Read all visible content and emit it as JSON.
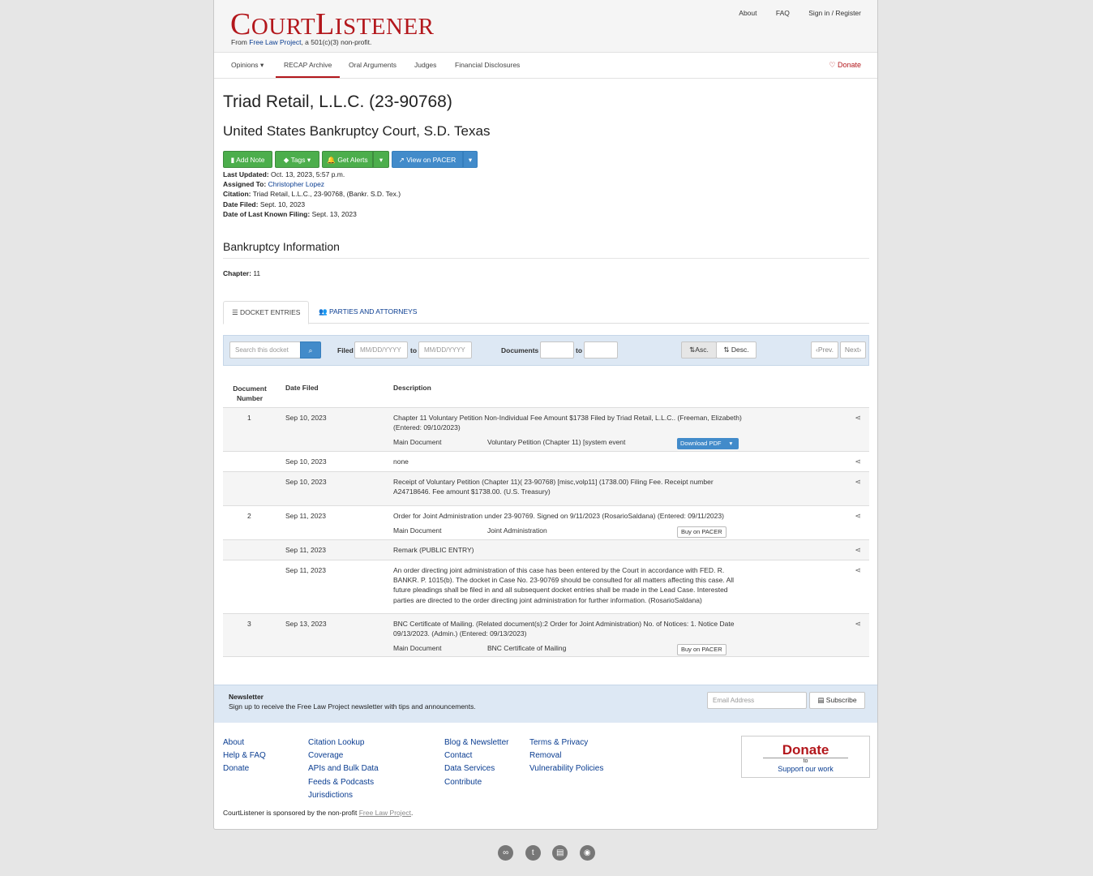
{
  "header": {
    "logo_big_c": "C",
    "logo_ourt": "OURT",
    "logo_big_l": "L",
    "logo_istener": "ISTENER",
    "tagline_prefix": "From ",
    "tagline_link": "Free Law Project",
    "tagline_suffix": ", a 501(c)(3) non-profit.",
    "links": [
      "About",
      "FAQ",
      "Sign in / Register"
    ]
  },
  "nav": {
    "items": [
      "Opinions",
      "RECAP Archive",
      "Oral Arguments",
      "Judges",
      "Financial Disclosures"
    ],
    "donate": "Donate"
  },
  "case": {
    "title": "Triad Retail, L.L.C. (23-90768)",
    "court": "United States Bankruptcy Court, S.D. Texas",
    "buttons": {
      "add_note": "Add Note",
      "tags": "Tags",
      "get_alerts": "Get Alerts",
      "view_pacer": "View on PACER"
    },
    "meta": {
      "last_updated_label": "Last Updated:",
      "last_updated": "Oct. 13, 2023, 5:57 p.m.",
      "assigned_label": "Assigned To:",
      "assigned": "Christopher Lopez",
      "citation_label": "Citation:",
      "citation": "Triad Retail, L.L.C., 23-90768, (Bankr. S.D. Tex.)",
      "date_filed_label": "Date Filed:",
      "date_filed": "Sept. 10, 2023",
      "last_filing_label": "Date of Last Known Filing:",
      "last_filing": "Sept. 13, 2023"
    }
  },
  "bankruptcy": {
    "title": "Bankruptcy Information",
    "chapter_label": "Chapter:",
    "chapter": "11"
  },
  "tabs": [
    "DOCKET ENTRIES",
    "PARTIES AND ATTORNEYS"
  ],
  "filter": {
    "search_placeholder": "Search this docket",
    "filed_label": "Filed",
    "date_placeholder": "MM/DD/YYYY",
    "to_label": "to",
    "documents_label": "Documents",
    "asc": "Asc.",
    "desc": "Desc.",
    "prev": "Prev.",
    "next": "Next"
  },
  "table": {
    "headers": [
      "Document Number",
      "Date Filed",
      "Description"
    ],
    "rows": [
      {
        "num": "1",
        "date": "Sep 10, 2023",
        "desc": "Chapter 11 Voluntary Petition Non-Individual Fee Amount $1738 Filed by Triad Retail, L.L.C.. (Freeman, Elizabeth) (Entered: 09/10/2023)",
        "doc_label": "Main Document",
        "doc_desc": "Voluntary Petition (Chapter 11) [system event",
        "action": "Download PDF"
      },
      {
        "num": "",
        "date": "Sep 10, 2023",
        "desc": "none"
      },
      {
        "num": "",
        "date": "Sep 10, 2023",
        "desc": "Receipt of Voluntary Petition (Chapter 11)( 23-90768) [misc,volp11] (1738.00) Filing Fee. Receipt number A24718646. Fee amount $1738.00. (U.S. Treasury)"
      },
      {
        "num": "2",
        "date": "Sep 11, 2023",
        "desc": "Order for Joint Administration under 23-90769. Signed on 9/11/2023 (RosarioSaldana) (Entered: 09/11/2023)",
        "doc_label": "Main Document",
        "doc_desc": "Joint Administration",
        "action": "Buy on PACER"
      },
      {
        "num": "",
        "date": "Sep 11, 2023",
        "desc": "Remark (PUBLIC ENTRY)"
      },
      {
        "num": "",
        "date": "Sep 11, 2023",
        "desc": "An order directing joint administration of this case has been entered by the Court in accordance with FED. R. BANKR. P. 1015(b). The docket in Case No. 23-90769 should be consulted for all matters affecting this case. All future pleadings shall be filed in and all subsequent docket entries shall be made in the Lead Case. Interested parties are directed to the order directing joint administration for further information. (RosarioSaldana)"
      },
      {
        "num": "3",
        "date": "Sep 13, 2023",
        "desc": "BNC Certificate of Mailing. (Related document(s):2 Order for Joint Administration) No. of Notices: 1. Notice Date 09/13/2023. (Admin.) (Entered: 09/13/2023)",
        "doc_label": "Main Document",
        "doc_desc": "BNC Certificate of Mailing",
        "action": "Buy on PACER"
      }
    ]
  },
  "newsletter": {
    "title": "Newsletter",
    "text": "Sign up to receive the Free Law Project newsletter with tips and announcements.",
    "email_placeholder": "Email Address",
    "subscribe": "Subscribe"
  },
  "footer": {
    "col1": [
      "About",
      "Help & FAQ",
      "Donate"
    ],
    "col2": [
      "Citation Lookup",
      "Coverage",
      "APIs and Bulk Data",
      "Feeds & Podcasts",
      "Jurisdictions"
    ],
    "col3": [
      "Blog & Newsletter",
      "Contact",
      "Data Services",
      "Contribute"
    ],
    "col4": [
      "Terms & Privacy",
      "Removal",
      "Vulnerability Policies"
    ],
    "donate_title": "Donate",
    "donate_to": "to",
    "donate_support": "Support our work",
    "sponsor_prefix": "CourtListener is sponsored by the non-profit ",
    "sponsor_link": "Free Law Project",
    "sponsor_suffix": "."
  },
  "social_icons": [
    "link-icon",
    "twitter-icon",
    "newsletter-icon",
    "github-icon"
  ],
  "colors": {
    "brand_red": "#b3171c",
    "link_blue": "#0a3d91",
    "green_button": "#4cae4c",
    "blue_button": "#428bca"
  }
}
